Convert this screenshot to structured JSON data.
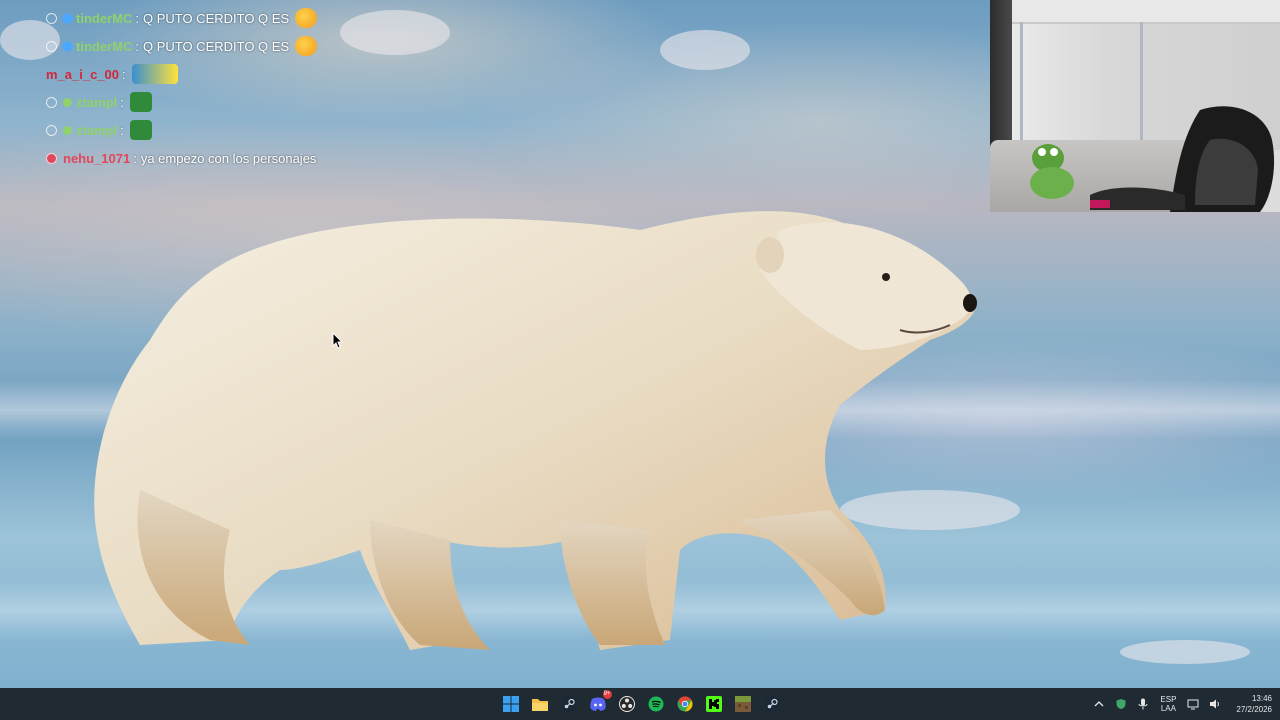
{
  "chat": {
    "messages": [
      {
        "user": "tinderMC",
        "separator": ":",
        "text": "Q PUTO CERDITO Q ES",
        "user_color": "#8fd16a",
        "badge_color": "#4aa8ff",
        "has_emote": true
      },
      {
        "user": "tinderMC",
        "separator": ":",
        "text": "Q PUTO CERDITO Q ES",
        "user_color": "#8fd16a",
        "badge_color": "#4aa8ff",
        "has_emote": true
      },
      {
        "user": "m_a_i_c_00",
        "separator": ":",
        "text": "",
        "user_color": "#d2283a",
        "badge_color": "",
        "has_emote": true
      },
      {
        "user": "ztampl",
        "separator": ":",
        "text": "",
        "user_color": "#8fd16a",
        "badge_color": "#8fd16a",
        "has_emote": true
      },
      {
        "user": "ztampl",
        "separator": ":",
        "text": "",
        "user_color": "#8fd16a",
        "badge_color": "#8fd16a",
        "has_emote": true
      },
      {
        "user": "nehu_1071",
        "separator": ":",
        "text": "ya empezo con los personajes",
        "user_color": "#e0485b",
        "badge_color": "",
        "has_emote": false
      }
    ]
  },
  "webcam": {
    "label": "webcam-feed"
  },
  "taskbar": {
    "apps": [
      {
        "name": "start",
        "icon": "windows-icon",
        "color": "#3ba0f0"
      },
      {
        "name": "file-explorer",
        "icon": "folder-icon",
        "color": "#f2c046"
      },
      {
        "name": "steam",
        "icon": "steam-icon",
        "color": "#c7d5e0"
      },
      {
        "name": "discord",
        "icon": "discord-icon",
        "color": "#5865f2",
        "badge": "9+"
      },
      {
        "name": "obs",
        "icon": "obs-icon",
        "color": "#e8e8e8"
      },
      {
        "name": "spotify",
        "icon": "spotify-icon",
        "color": "#1db954"
      },
      {
        "name": "chrome",
        "icon": "chrome-icon",
        "color": "#ea4335"
      },
      {
        "name": "kick",
        "icon": "kick-icon",
        "color": "#53fc18"
      },
      {
        "name": "minecraft",
        "icon": "minecraft-icon",
        "color": "#7a9a3a"
      },
      {
        "name": "steam-2",
        "icon": "steam-icon",
        "color": "#c7d5e0"
      }
    ],
    "tray": {
      "language_top": "ESP",
      "language_bottom": "LAA",
      "time": "13:46",
      "date": "27/2/2026"
    }
  }
}
